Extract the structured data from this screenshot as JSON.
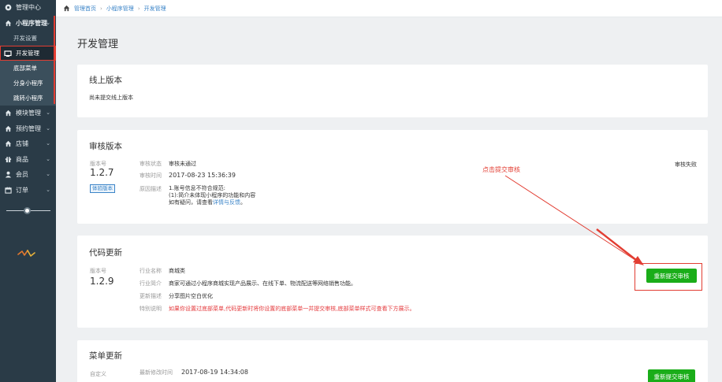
{
  "sidebar": {
    "items": [
      {
        "label": "管理中心",
        "icon": "dashboard-icon"
      },
      {
        "label": "小程序管理",
        "icon": "home-icon"
      },
      {
        "label": "开发设置"
      },
      {
        "label": "开发管理",
        "icon": "monitor-icon"
      },
      {
        "label": "底部菜单"
      },
      {
        "label": "分身小程序"
      },
      {
        "label": "跳转小程序"
      },
      {
        "label": "模块管理",
        "icon": "home-icon"
      },
      {
        "label": "预约管理",
        "icon": "home-icon"
      },
      {
        "label": "店铺",
        "icon": "home-icon"
      },
      {
        "label": "商品",
        "icon": "gift-icon"
      },
      {
        "label": "会员",
        "icon": "user-icon"
      },
      {
        "label": "订单",
        "icon": "calendar-icon"
      }
    ]
  },
  "breadcrumb": {
    "home": "管理首页",
    "level2": "小程序管理",
    "level3": "开发管理"
  },
  "page": {
    "title": "开发管理"
  },
  "online": {
    "title": "线上版本",
    "text": "尚未提交线上版本"
  },
  "review": {
    "title": "审核版本",
    "version_label": "版本号",
    "version": "1.2.7",
    "badge": "体验版本",
    "status_label": "审核状态",
    "status_value": "审核未通过",
    "time_label": "审核时间",
    "time_value": "2017-08-23 15:36:39",
    "reason_label": "原因描述",
    "reason_line1": "1.账号信息不符合规范:",
    "reason_line2": "(1):简介未体现小程序的功能和内容",
    "reason_line3_prefix": "如有疑问，请查看",
    "reason_link": "详情与反馈",
    "reason_line3_suffix": "。",
    "result": "审核失败"
  },
  "code_update": {
    "title": "代码更新",
    "version_label": "版本号",
    "version": "1.2.9",
    "industry_label": "行业名称",
    "industry_value": "商城类",
    "intro_label": "行业简介",
    "intro_value": "商家可通过小程序商城实现产品展示、在线下单、物流配送等网络销售功能。",
    "desc_label": "更新描述",
    "desc_value": "分享图片空白优化",
    "note_label": "特别说明",
    "note_value": "如果你设置过底部菜单,代码更新时将你设置的底部菜单一并提交审核,底部菜单样式可查看下方展示。",
    "button": "重新提交审核"
  },
  "menu_update": {
    "title": "菜单更新",
    "custom_label": "自定义",
    "modified_label": "最新修改时间",
    "modified_value": "2017-08-19 14:34:08",
    "button": "重新提交审核"
  },
  "annotation": {
    "text": "点击提交审核"
  },
  "colors": {
    "sidebar": "#2a3b47",
    "accent_green": "#1aad19",
    "link": "#3b84c8",
    "annotation_red": "#e23d32"
  }
}
